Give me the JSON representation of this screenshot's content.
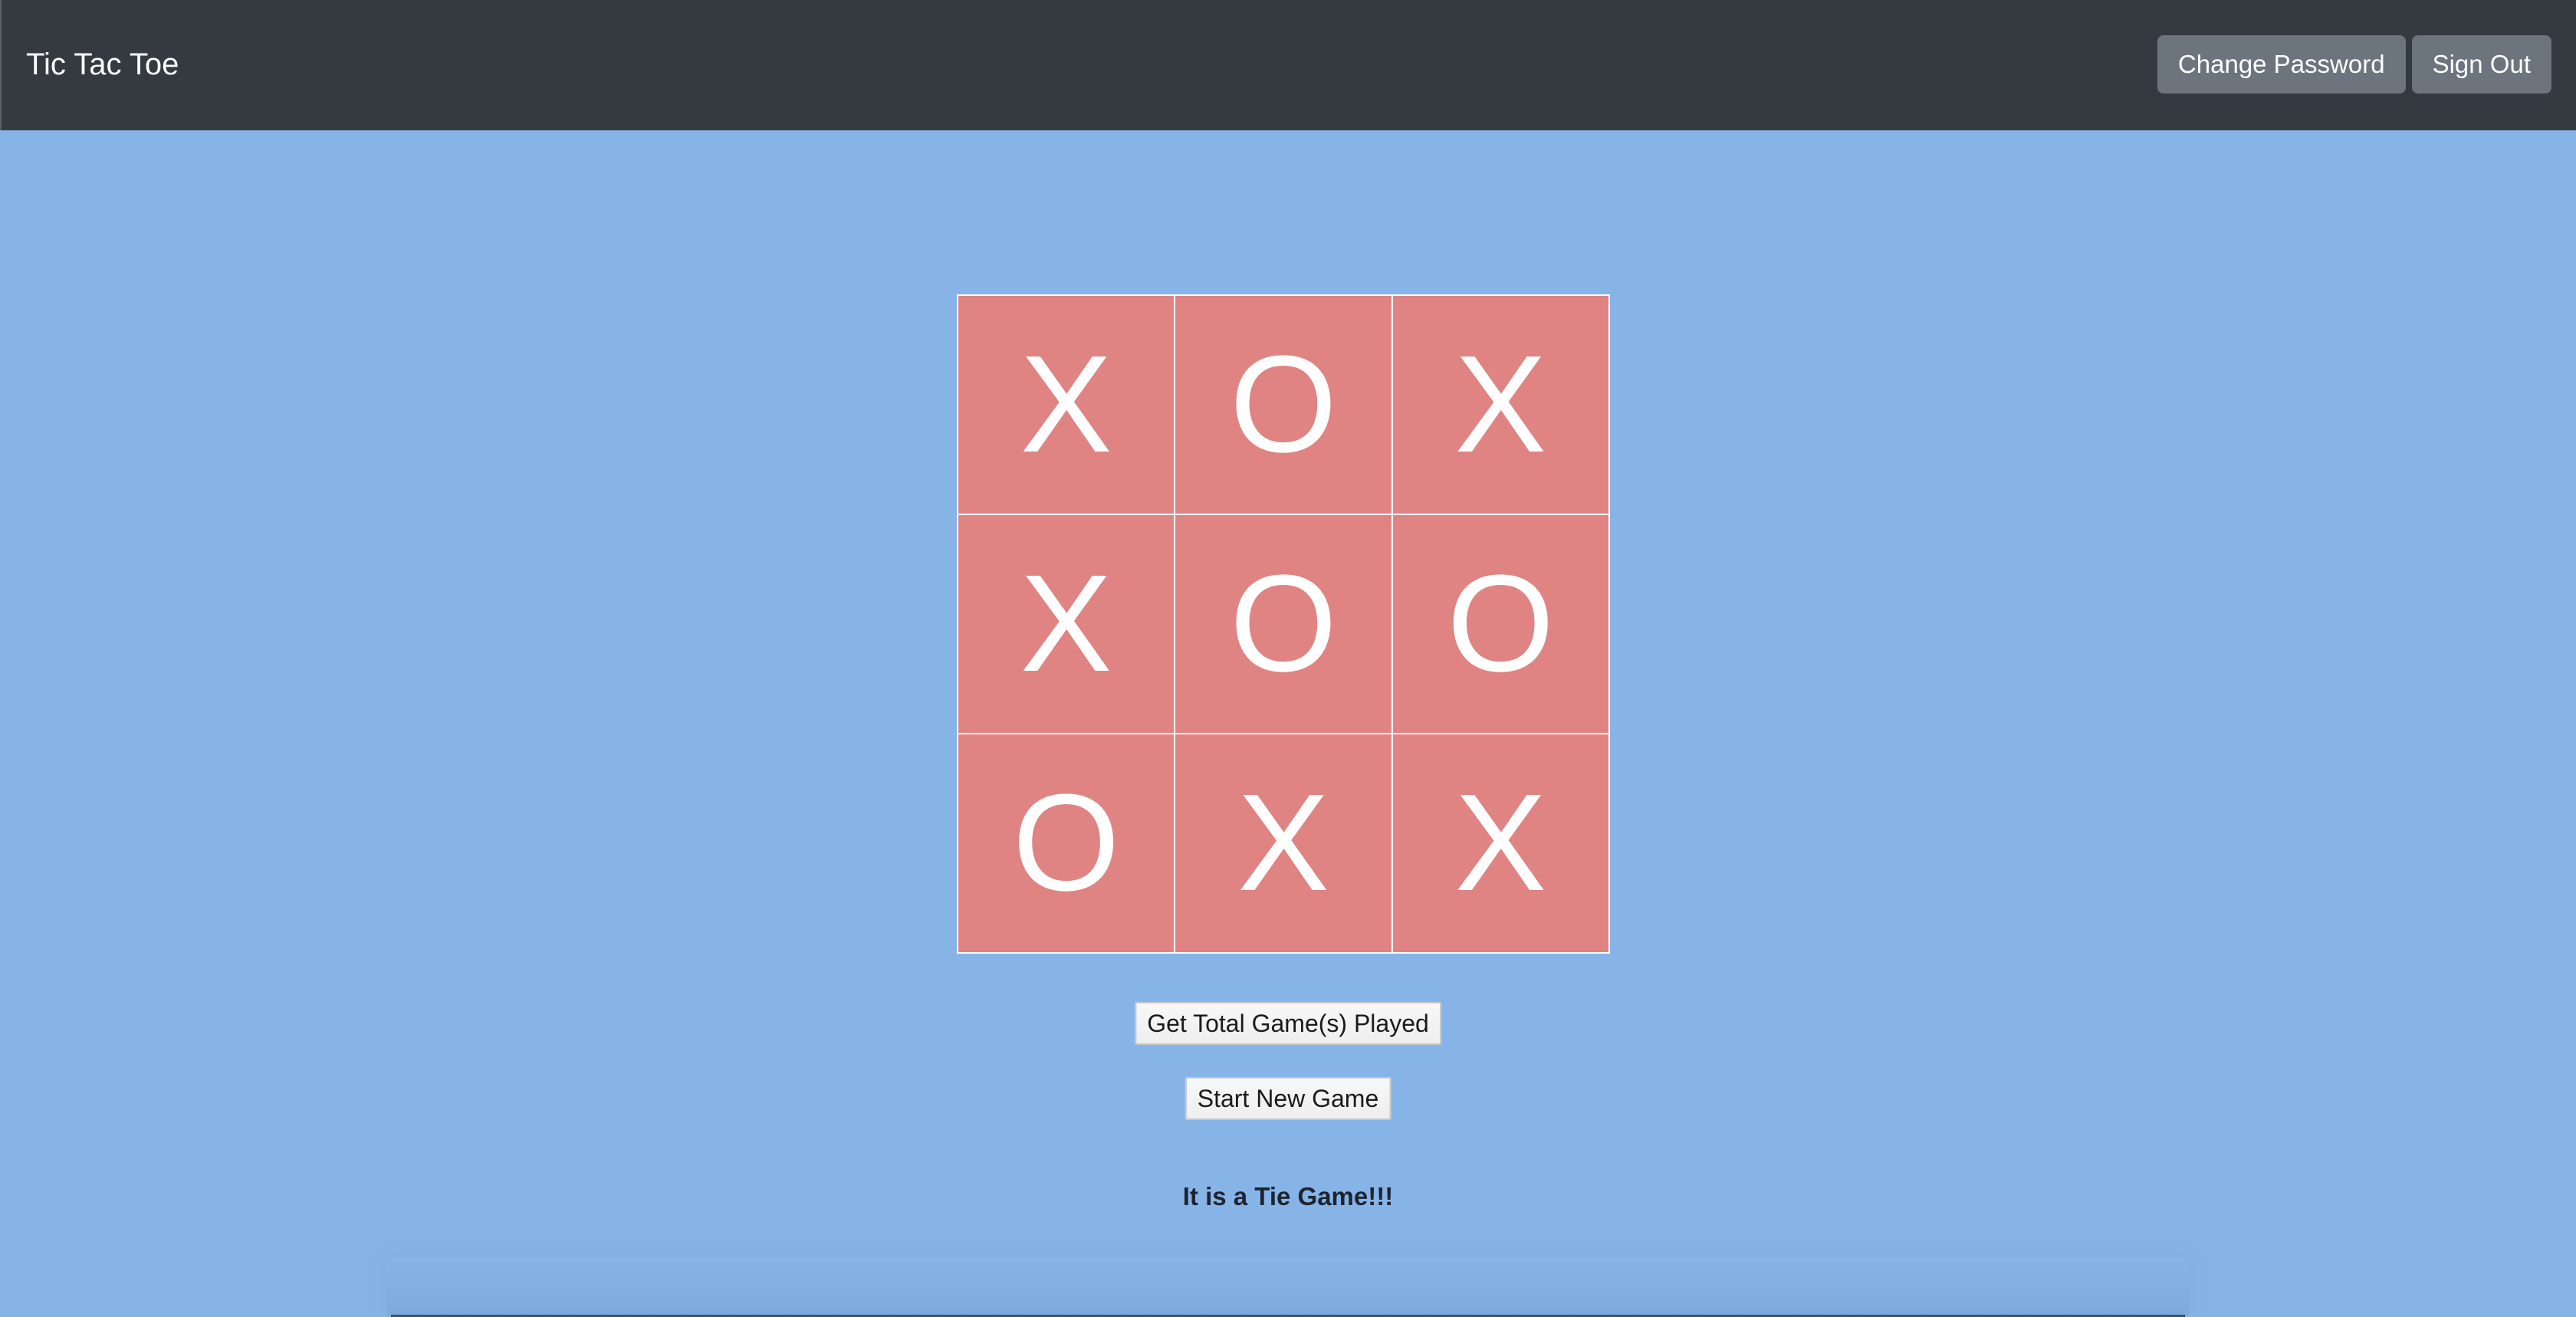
{
  "navbar": {
    "brand": "Tic Tac Toe",
    "buttons": {
      "change_password": "Change Password",
      "sign_out": "Sign Out"
    }
  },
  "colors": {
    "navbar_bg": "#343a40",
    "page_bg": "#87b4e7",
    "cell_bg": "#df8482",
    "nav_button_bg": "#6c757d"
  },
  "board": {
    "cells": [
      "X",
      "O",
      "X",
      "X",
      "O",
      "O",
      "O",
      "X",
      "X"
    ]
  },
  "actions": {
    "total_games": "Get Total Game(s) Played",
    "new_game": "Start New Game"
  },
  "status": {
    "message": "It is a Tie Game!!!"
  }
}
